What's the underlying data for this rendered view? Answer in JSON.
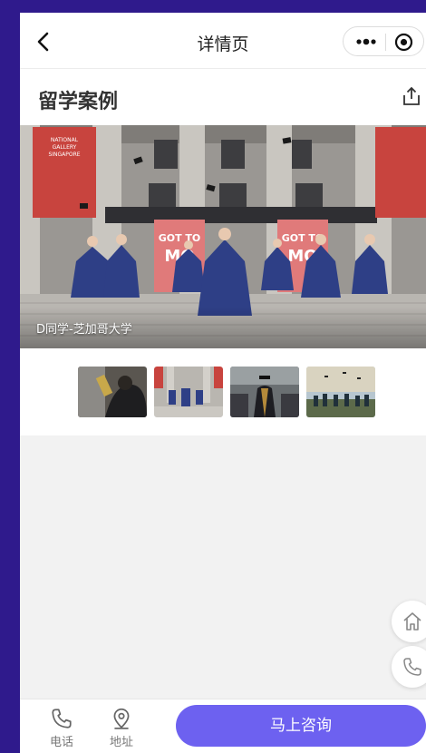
{
  "navbar": {
    "title": "详情页",
    "back_icon": "chevron-left-icon",
    "more_icon": "more-dots-icon",
    "close_icon": "target-icon"
  },
  "header": {
    "title": "留学案例",
    "share_icon": "share-icon"
  },
  "hero": {
    "caption": "D同学-芝加哥大学",
    "signs": {
      "left_banner": "NATIONAL GALLERY SINGAPORE",
      "center_banner": "GOT TO MOVE"
    }
  },
  "thumbnails": [
    {
      "name": "thumb-reading"
    },
    {
      "name": "thumb-graduation-steps",
      "active": true
    },
    {
      "name": "thumb-gown-back"
    },
    {
      "name": "thumb-caps-toss"
    }
  ],
  "floating": {
    "home_icon": "home-icon",
    "phone_icon": "phone-icon"
  },
  "bottom": {
    "phone_label": "电话",
    "address_label": "地址",
    "consult_label": "马上咨询"
  },
  "colors": {
    "accent": "#6d61f0",
    "frame": "#2f1a8c"
  }
}
